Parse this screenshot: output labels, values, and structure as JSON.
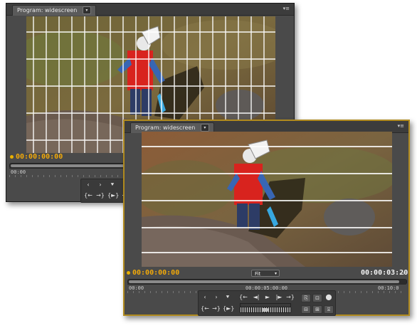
{
  "back_monitor": {
    "tab_label": "Program: widescreen",
    "tab_menu_icon": "chevron-down-icon",
    "panel_menu_icon": "panel-menu-icon",
    "timecode": "00:00:00:00",
    "ruler_start": "00:00",
    "overlay": "grid",
    "transport_row1": [
      "‹",
      "›",
      "⯆",
      "{"
    ],
    "transport_row2": [
      "{←",
      "→}",
      "{►}",
      "⇥"
    ]
  },
  "front_monitor": {
    "tab_label": "Program: widescreen",
    "tab_menu_icon": "chevron-down-icon",
    "panel_menu_icon": "panel-menu-icon",
    "timecode_current": "00:00:00:00",
    "zoom_value": "Fit",
    "timecode_duration": "00:00:03:20",
    "ruler_labels": [
      "00:00",
      "00:00:05:00:00",
      "00:10:0"
    ],
    "overlay": "horizontal-lines",
    "transport_row1": [
      "‹",
      "›",
      "⯆",
      "{←",
      "◄|",
      "►",
      "|►",
      "→}",
      "⎘",
      "⊡",
      "⬤"
    ],
    "transport_row2": [
      "{←",
      "→}",
      "{►}",
      "⊟",
      "⊞",
      "⌻"
    ]
  },
  "colors": {
    "accent_timecode": "#f0a80a",
    "panel_bg": "#4a4a4a",
    "active_border": "#b08a1e"
  }
}
